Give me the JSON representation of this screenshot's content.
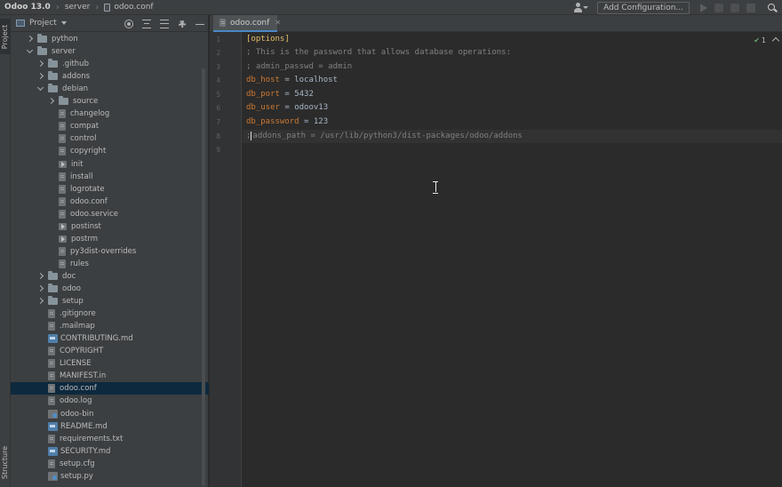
{
  "navbar": {
    "breadcrumbs": [
      "Odoo 13.0",
      "server",
      "odoo.conf"
    ],
    "add_configuration": "Add Configuration..."
  },
  "toolstrip": {
    "project_tab": "Project",
    "structure_tab": "Structure"
  },
  "project_panel": {
    "title": "Project",
    "tree": [
      {
        "label": "python",
        "type": "folder",
        "state": "closed",
        "depth": 1
      },
      {
        "label": "server",
        "type": "folder",
        "state": "open",
        "depth": 1
      },
      {
        "label": ".github",
        "type": "folder",
        "state": "closed",
        "depth": 2
      },
      {
        "label": "addons",
        "type": "folder",
        "state": "closed",
        "depth": 2
      },
      {
        "label": "debian",
        "type": "folder",
        "state": "open",
        "depth": 2
      },
      {
        "label": "source",
        "type": "folder",
        "state": "closed",
        "depth": 3
      },
      {
        "label": "changelog",
        "type": "file",
        "depth": 3
      },
      {
        "label": "compat",
        "type": "file",
        "depth": 3
      },
      {
        "label": "control",
        "type": "file",
        "depth": 3
      },
      {
        "label": "copyright",
        "type": "file",
        "depth": 3
      },
      {
        "label": "init",
        "type": "exe",
        "depth": 3
      },
      {
        "label": "install",
        "type": "file",
        "depth": 3
      },
      {
        "label": "logrotate",
        "type": "file",
        "depth": 3
      },
      {
        "label": "odoo.conf",
        "type": "file",
        "depth": 3
      },
      {
        "label": "odoo.service",
        "type": "file",
        "depth": 3
      },
      {
        "label": "postinst",
        "type": "exe",
        "depth": 3
      },
      {
        "label": "postrm",
        "type": "exe",
        "depth": 3
      },
      {
        "label": "py3dist-overrides",
        "type": "file",
        "depth": 3
      },
      {
        "label": "rules",
        "type": "file",
        "depth": 3
      },
      {
        "label": "doc",
        "type": "folder",
        "state": "closed",
        "depth": 2
      },
      {
        "label": "odoo",
        "type": "folder",
        "state": "closed",
        "depth": 2
      },
      {
        "label": "setup",
        "type": "folder",
        "state": "closed",
        "depth": 2
      },
      {
        "label": ".gitignore",
        "type": "file",
        "depth": 2
      },
      {
        "label": ".mailmap",
        "type": "file",
        "depth": 2
      },
      {
        "label": "CONTRIBUTING.md",
        "type": "md",
        "depth": 2
      },
      {
        "label": "COPYRIGHT",
        "type": "file",
        "depth": 2
      },
      {
        "label": "LICENSE",
        "type": "file",
        "depth": 2
      },
      {
        "label": "MANIFEST.in",
        "type": "file",
        "depth": 2
      },
      {
        "label": "odoo.conf",
        "type": "file",
        "depth": 2,
        "selected": true
      },
      {
        "label": "odoo.log",
        "type": "file",
        "depth": 2
      },
      {
        "label": "odoo-bin",
        "type": "bin",
        "depth": 2
      },
      {
        "label": "README.md",
        "type": "md",
        "depth": 2
      },
      {
        "label": "requirements.txt",
        "type": "file",
        "depth": 2
      },
      {
        "label": "SECURITY.md",
        "type": "md",
        "depth": 2
      },
      {
        "label": "setup.cfg",
        "type": "file",
        "depth": 2
      },
      {
        "label": "setup.py",
        "type": "bin",
        "depth": 2
      }
    ]
  },
  "editor": {
    "tab_label": "odoo.conf",
    "inspection_count": "1",
    "line_numbers": [
      "1",
      "2",
      "3",
      "4",
      "5",
      "6",
      "7",
      "8",
      "9"
    ],
    "lines": {
      "l1": "[options]",
      "l2": "; This is the password that allows database operations:",
      "l3": "; admin_passwd = admin",
      "l4_key": "db_host",
      "l4_val": "localhost",
      "l5_key": "db_port",
      "l5_val": "5432",
      "l6_key": "db_user",
      "l6_val": "odoov13",
      "l7_key": "db_password",
      "l7_val": "123",
      "l8_prefix": ";",
      "l8_rest": "addons_path = /usr/lib/python3/dist-packages/odoo/addons",
      "equals": " = "
    }
  }
}
